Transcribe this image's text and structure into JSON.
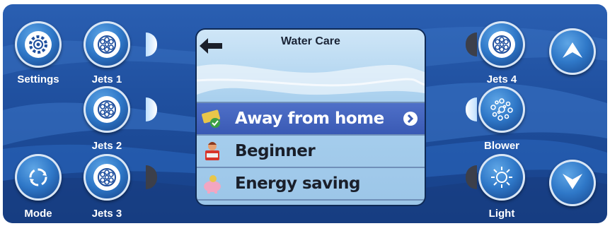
{
  "left_buttons": [
    {
      "label": "Settings",
      "icon": "gear-icon"
    },
    {
      "label": "Jets 1",
      "icon": "jets-icon",
      "indicator": "on"
    },
    {
      "label": "Jets 2",
      "icon": "jets-icon",
      "indicator": "on"
    },
    {
      "label": "Mode",
      "icon": "cycle-arrows-icon"
    },
    {
      "label": "Jets 3",
      "icon": "jets-icon",
      "indicator": "off"
    }
  ],
  "right_buttons": [
    {
      "label": "Jets 4",
      "icon": "jets-icon",
      "indicator": "off"
    },
    {
      "label": "Blower",
      "icon": "bubbles-icon",
      "indicator": "on"
    },
    {
      "label": "Light",
      "icon": "sun-icon",
      "indicator": "off"
    }
  ],
  "arrows": {
    "up": "up-arrow-icon",
    "down": "down-arrow-icon"
  },
  "screen": {
    "title": "Water Care",
    "items": [
      {
        "label": "Away from home",
        "icon": "ticket-icon",
        "selected": true
      },
      {
        "label": "Beginner",
        "icon": "person-reading-icon",
        "selected": false
      },
      {
        "label": "Energy saving",
        "icon": "piggy-bank-icon",
        "selected": false
      }
    ]
  },
  "colors": {
    "panel": "#1f4f9e",
    "selection": "#3a5ab4",
    "indicator_off": "#3c3f4a"
  }
}
